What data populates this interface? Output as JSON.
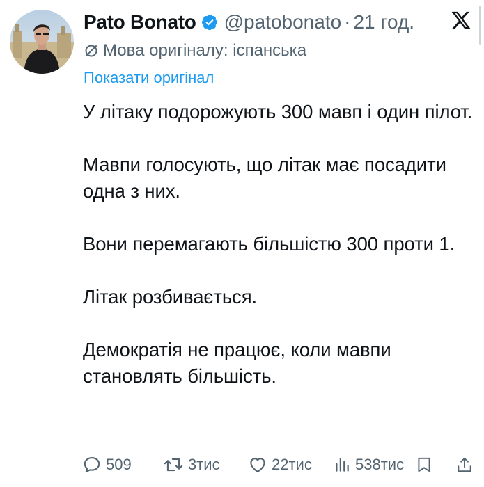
{
  "post": {
    "author_name": "Pato Bonato",
    "handle": "@patobonato",
    "separator": "·",
    "time": "21 год.",
    "translation_note": "Мова оригіналу: іспанська",
    "show_original": "Показати оригінал",
    "paragraphs": [
      "У літаку подорожують 300 мавп і один пілот.",
      "Мавпи голосують, що літак має посадити одна з них.",
      "Вони перемагають більшістю 300 проти 1.",
      "Літак розбивається.",
      "Демократія не працює, коли мавпи становлять більшість."
    ]
  },
  "actions": {
    "replies": "509",
    "reposts": "3тис",
    "likes": "22тис",
    "views": "538тис"
  },
  "icons": {
    "verified": "verified-badge-icon",
    "platform": "x-logo-icon",
    "translate": "translate-icon",
    "reply": "reply-icon",
    "repost": "repost-icon",
    "like": "heart-icon",
    "views": "views-icon",
    "bookmark": "bookmark-icon",
    "share": "share-icon"
  },
  "colors": {
    "text": "#0f1419",
    "secondary": "#536471",
    "link": "#1d9bf0",
    "verified": "#1d9bf0"
  }
}
